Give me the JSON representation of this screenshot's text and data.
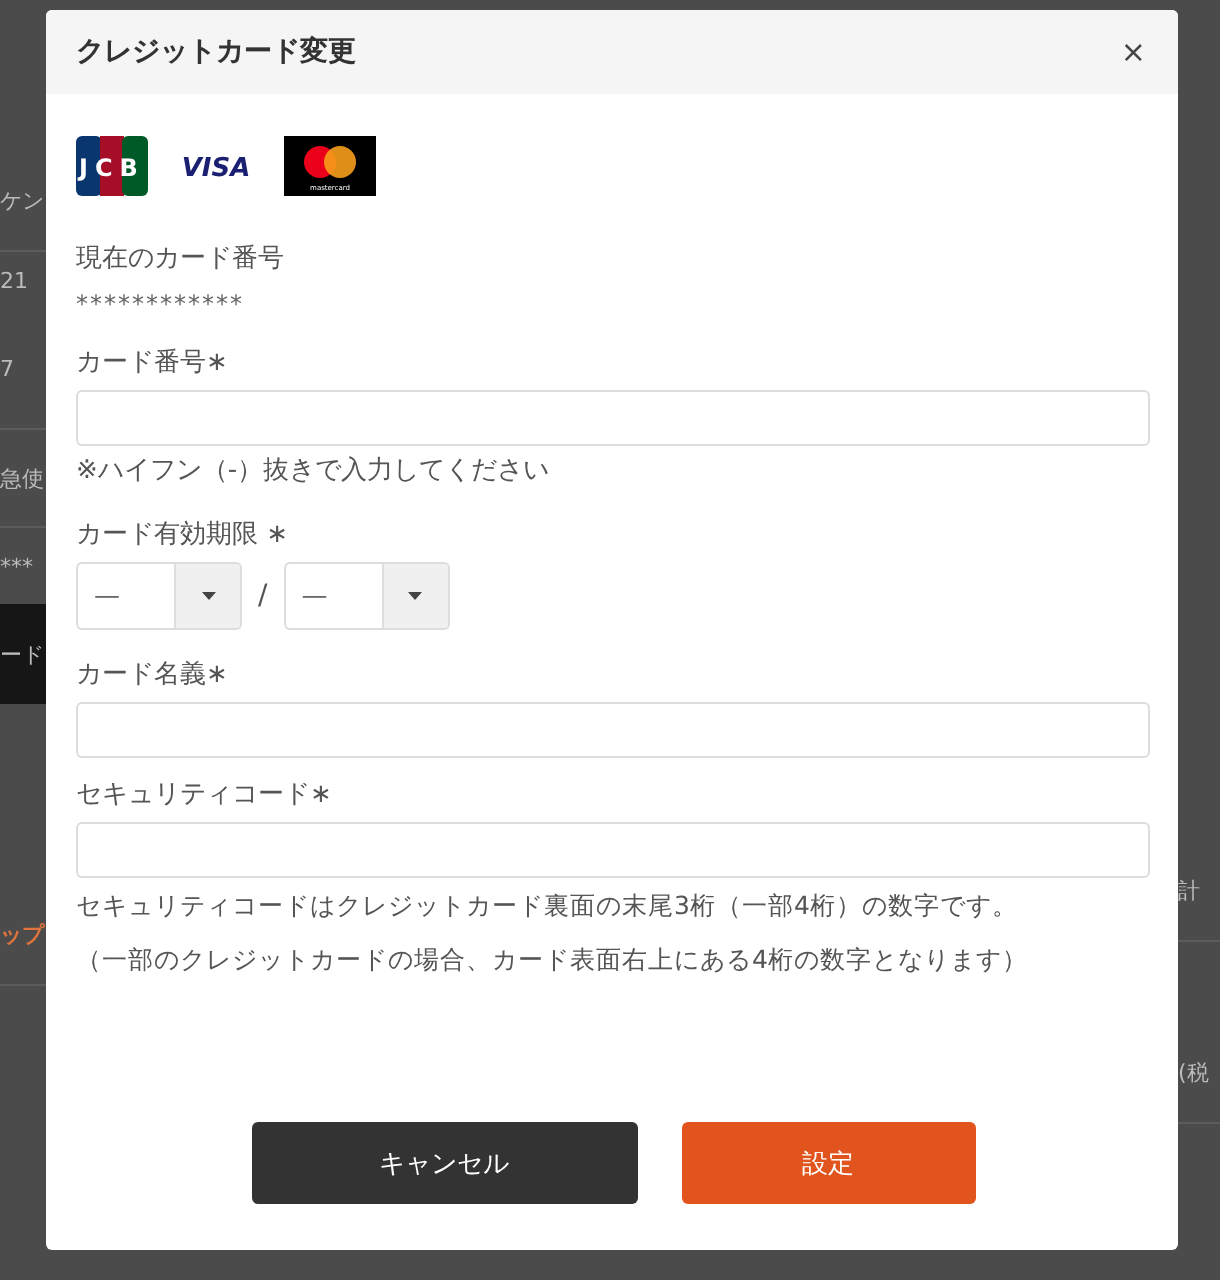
{
  "background": {
    "left": [
      {
        "text": "ケン",
        "kind": "plain"
      },
      {
        "text": "21",
        "kind": "plain"
      },
      {
        "text": "7",
        "kind": "plain"
      },
      {
        "text": "急使",
        "kind": "plain"
      },
      {
        "text": "***",
        "kind": "plain"
      },
      {
        "text": "ード",
        "kind": "dark"
      },
      {
        "text": "ップ",
        "kind": "accent"
      }
    ],
    "right": [
      {
        "text": "計"
      },
      {
        "text": "(税"
      }
    ]
  },
  "modal": {
    "title": "クレジットカード変更",
    "close": "×",
    "card_brands": [
      {
        "kind": "jcb",
        "text": "JCB"
      },
      {
        "kind": "visa",
        "text": "VISA"
      },
      {
        "kind": "mastercard",
        "text": "mastercard"
      }
    ],
    "current_card": {
      "label": "現在のカード番号",
      "value": "************"
    },
    "fields": [
      {
        "kind": "text",
        "label": "カード番号",
        "required": "∗",
        "hint": "※ハイフン（-）抜きで入力してください"
      },
      {
        "kind": "expiry",
        "label": "カード有効期限",
        "required": "∗",
        "selects": [
          "—",
          "—"
        ],
        "separator": "/"
      },
      {
        "kind": "text",
        "label": "カード名義",
        "required": "∗"
      },
      {
        "kind": "text",
        "label": "セキュリティコード",
        "required": "∗",
        "notes": [
          "セキュリティコードはクレジットカード裏面の末尾3桁（一部4桁）の数字です。",
          "（一部のクレジットカードの場合、カード表面右上にある4桁の数字となります）"
        ]
      }
    ],
    "buttons": [
      {
        "kind": "secondary",
        "label": "キャンセル"
      },
      {
        "kind": "primary",
        "label": "設定"
      }
    ]
  }
}
